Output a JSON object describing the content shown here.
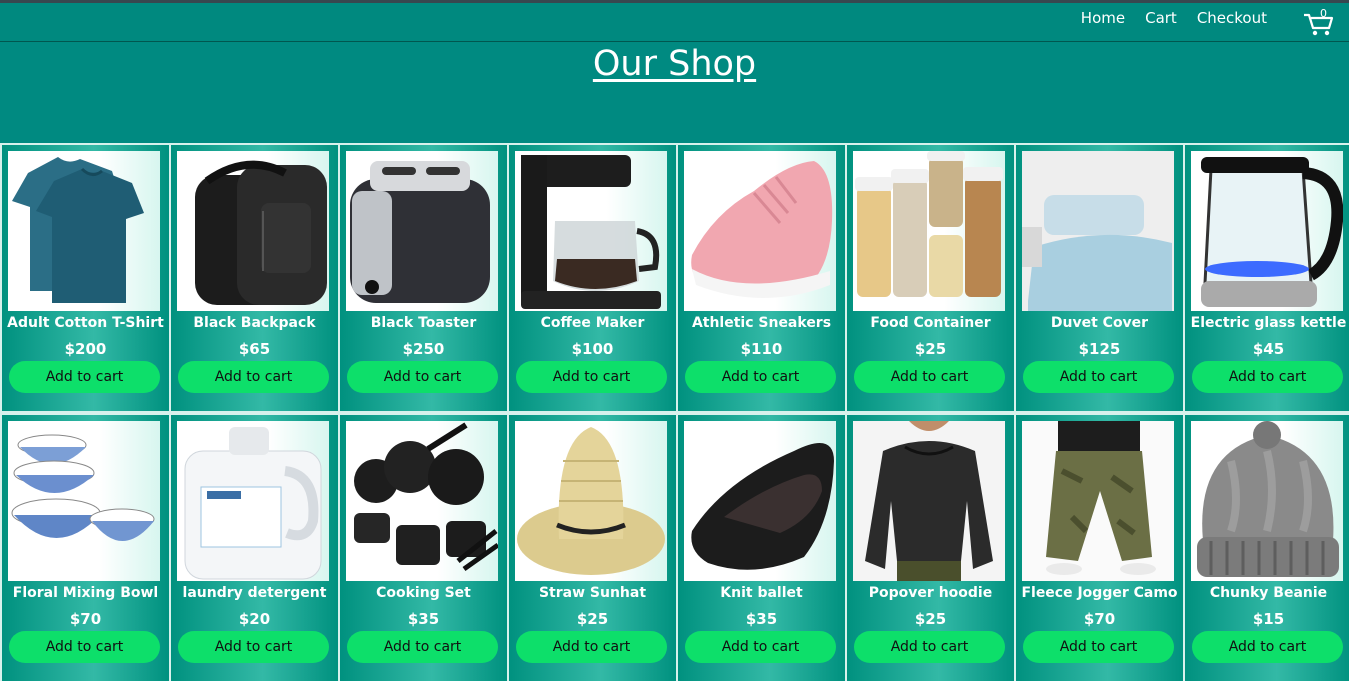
{
  "nav": {
    "links": [
      "Home",
      "Cart",
      "Checkout"
    ],
    "cart_count": "0"
  },
  "hero": {
    "title": "Our Shop"
  },
  "products": [
    {
      "name": "Adult Cotton T-Shirt",
      "price": "$200",
      "button": "Add to cart",
      "image": "tshirt"
    },
    {
      "name": "Black Backpack",
      "price": "$65",
      "button": "Add to cart",
      "image": "backpack"
    },
    {
      "name": "Black Toaster",
      "price": "$250",
      "button": "Add to cart",
      "image": "toaster"
    },
    {
      "name": "Coffee Maker",
      "price": "$100",
      "button": "Add to cart",
      "image": "coffee"
    },
    {
      "name": "Athletic Sneakers",
      "price": "$110",
      "button": "Add to cart",
      "image": "sneaker"
    },
    {
      "name": "Food Container",
      "price": "$25",
      "button": "Add to cart",
      "image": "container"
    },
    {
      "name": "Duvet Cover",
      "price": "$125",
      "button": "Add to cart",
      "image": "duvet"
    },
    {
      "name": "Electric glass kettle",
      "price": "$45",
      "button": "Add to cart",
      "image": "kettle"
    },
    {
      "name": "Floral Mixing Bowl",
      "price": "$70",
      "button": "Add to cart",
      "image": "bowl"
    },
    {
      "name": "laundry detergent",
      "price": "$20",
      "button": "Add to cart",
      "image": "detergent"
    },
    {
      "name": "Cooking Set",
      "price": "$35",
      "button": "Add to cart",
      "image": "pots"
    },
    {
      "name": "Straw Sunhat",
      "price": "$25",
      "button": "Add to cart",
      "image": "hat"
    },
    {
      "name": "Knit ballet",
      "price": "$35",
      "button": "Add to cart",
      "image": "flat"
    },
    {
      "name": "Popover hoodie",
      "price": "$25",
      "button": "Add to cart",
      "image": "hoodie"
    },
    {
      "name": "Fleece Jogger Camo",
      "price": "$70",
      "button": "Add to cart",
      "image": "jogger"
    },
    {
      "name": "Chunky Beanie",
      "price": "$15",
      "button": "Add to cart",
      "image": "beanie"
    }
  ]
}
